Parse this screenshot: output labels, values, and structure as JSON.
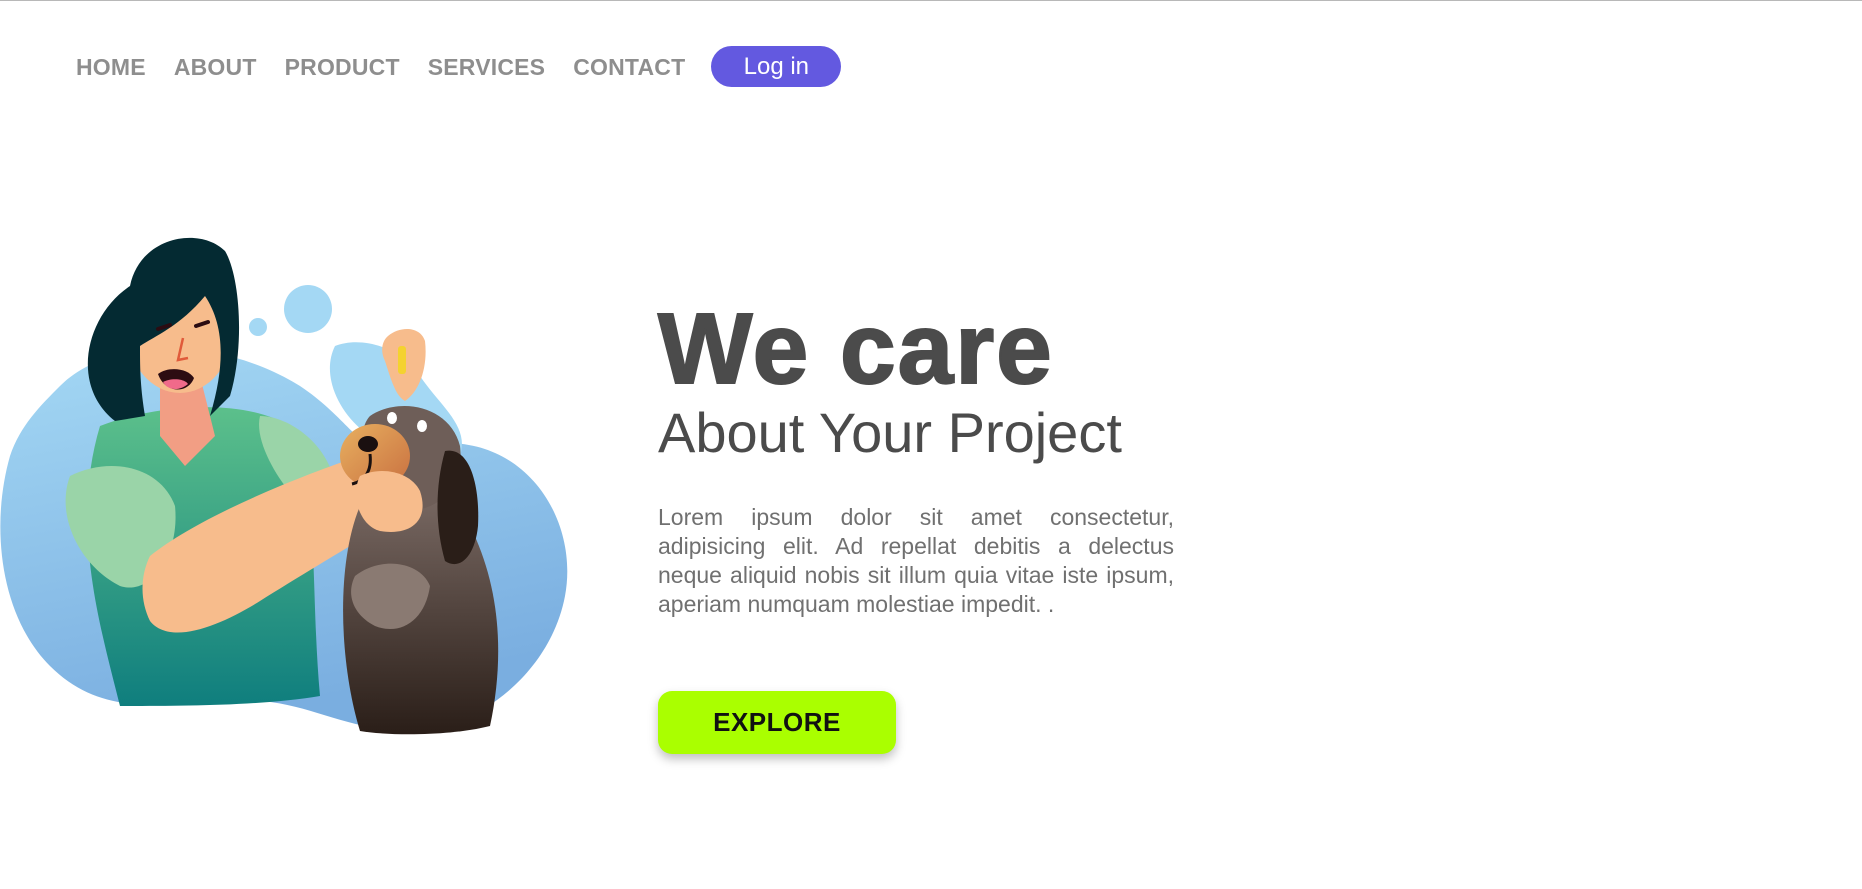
{
  "nav": {
    "items": [
      {
        "label": "HOME"
      },
      {
        "label": "ABOUT"
      },
      {
        "label": "PRODUCT"
      },
      {
        "label": "SERVICES"
      },
      {
        "label": "CONTACT"
      }
    ],
    "login_label": "Log in"
  },
  "hero": {
    "title": "We care",
    "subtitle": "About Your Project",
    "description": "Lorem ipsum dolor sit amet consectetur, adipisicing elit. Ad repellat debitis a delectus neque aliquid nobis sit illum quia vitae iste ipsum, aperiam numquam molestiae impedit. .",
    "cta_label": "EXPLORE"
  },
  "colors": {
    "accent": "#6359e0",
    "cta": "#aaff00",
    "heading": "#4b4b4b",
    "nav_text": "#8e8e8e"
  }
}
